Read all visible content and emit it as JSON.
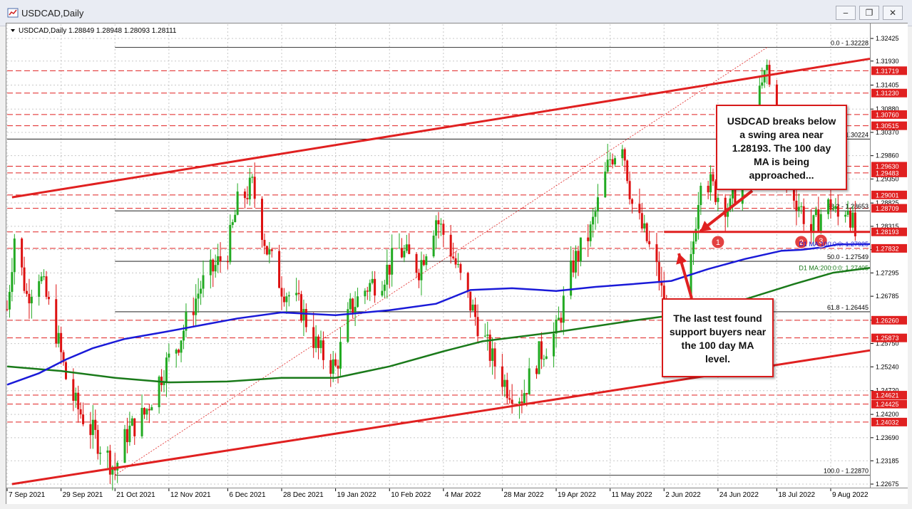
{
  "window": {
    "title": "USDCAD,Daily",
    "buttons": [
      "‒",
      "❐",
      "✕"
    ]
  },
  "header": {
    "symbol_line": "USDCAD,Daily  1.28849 1.28948 1.28093 1.28111"
  },
  "colors": {
    "up": "#22aa22",
    "down": "#dd1111",
    "ma100": "#1a1ad8",
    "ma200": "#1a7a1a",
    "trend": "#e02020",
    "level_label_bg": "#e02020"
  },
  "chart_data": {
    "type": "candlestick",
    "symbol": "USDCAD",
    "timeframe": "Daily",
    "ohlc_last": {
      "open": 1.28849,
      "high": 1.28948,
      "low": 1.28093,
      "close": 1.28111
    },
    "ylim": [
      1.22675,
      1.32425
    ],
    "xlim": [
      "2021-09-07",
      "2022-08-25"
    ],
    "y_ticks": [
      "1.32425",
      "1.31930",
      "1.31405",
      "1.30880",
      "1.30370",
      "1.29860",
      "1.29350",
      "1.28825",
      "1.28315",
      "1.27805",
      "1.27295",
      "1.26785",
      "1.26260",
      "1.25750",
      "1.25240",
      "1.24720",
      "1.24200",
      "1.23690",
      "1.23185",
      "1.22675"
    ],
    "x_ticks": [
      {
        "label": "7 Sep 2021",
        "date": "2021-09-07"
      },
      {
        "label": "29 Sep 2021",
        "date": "2021-09-29"
      },
      {
        "label": "21 Oct 2021",
        "date": "2021-10-21"
      },
      {
        "label": "12 Nov 2021",
        "date": "2021-11-12"
      },
      {
        "label": "6 Dec 2021",
        "date": "2021-12-06"
      },
      {
        "label": "28 Dec 2021",
        "date": "2021-12-28"
      },
      {
        "label": "19 Jan 2022",
        "date": "2022-01-19"
      },
      {
        "label": "10 Feb 2022",
        "date": "2022-02-10"
      },
      {
        "label": "4 Mar 2022",
        "date": "2022-03-04"
      },
      {
        "label": "28 Mar 2022",
        "date": "2022-03-28"
      },
      {
        "label": "19 Apr 2022",
        "date": "2022-04-19"
      },
      {
        "label": "11 May 2022",
        "date": "2022-05-11"
      },
      {
        "label": "2 Jun 2022",
        "date": "2022-06-02"
      },
      {
        "label": "24 Jun 2022",
        "date": "2022-06-24"
      },
      {
        "label": "18 Jul 2022",
        "date": "2022-07-18"
      },
      {
        "label": "9 Aug 2022",
        "date": "2022-08-09"
      }
    ],
    "level_labels": [
      {
        "value": "1.31719",
        "price": 1.31719
      },
      {
        "value": "1.31230",
        "price": 1.3123
      },
      {
        "value": "1.30760",
        "price": 1.3076
      },
      {
        "value": "1.30515",
        "price": 1.30515
      },
      {
        "value": "1.29630",
        "price": 1.2963
      },
      {
        "value": "1.29483",
        "price": 1.29483
      },
      {
        "value": "1.29001",
        "price": 1.29001
      },
      {
        "value": "1.28709",
        "price": 1.28709
      },
      {
        "value": "1.28193",
        "price": 1.28193
      },
      {
        "value": "1.27832",
        "price": 1.27832
      },
      {
        "value": "1.26260",
        "price": 1.2626
      },
      {
        "value": "1.25873",
        "price": 1.25873
      },
      {
        "value": "1.24621",
        "price": 1.24621
      },
      {
        "value": "1.24425",
        "price": 1.24425
      },
      {
        "value": "1.24032",
        "price": 1.24032
      }
    ],
    "fib_levels": [
      {
        "label": "0.0 - 1.32228",
        "price": 1.32228,
        "from": "2021-10-21"
      },
      {
        "label": "1.30224",
        "price": 1.30224,
        "from": "2021-09-07"
      },
      {
        "label": "38.2 - 1.28653",
        "price": 1.28653,
        "from": "2021-10-21"
      },
      {
        "label": "50.0 - 1.27549",
        "price": 1.27549,
        "from": "2021-10-21"
      },
      {
        "label": "61.8 - 1.26445",
        "price": 1.26445,
        "from": "2021-10-21"
      },
      {
        "label": "100.0 - 1.22870",
        "price": 1.2287,
        "from": "2021-10-21"
      }
    ],
    "ma_labels": [
      {
        "text": "D1 MA:100:0:0: 1.27925",
        "price": 1.27925,
        "series": "ma100"
      },
      {
        "text": "D1 MA:200:0:0: 1.27405",
        "price": 1.27405,
        "series": "ma200"
      }
    ],
    "ma100": [
      [
        "2021-09-07",
        1.2485
      ],
      [
        "2021-09-20",
        1.251
      ],
      [
        "2021-10-01",
        1.254
      ],
      [
        "2021-10-12",
        1.2565
      ],
      [
        "2021-10-25",
        1.2585
      ],
      [
        "2021-11-10",
        1.26
      ],
      [
        "2021-11-25",
        1.2615
      ],
      [
        "2021-12-10",
        1.263
      ],
      [
        "2021-12-28",
        1.2643
      ],
      [
        "2022-01-19",
        1.2637
      ],
      [
        "2022-02-10",
        1.2648
      ],
      [
        "2022-03-01",
        1.2662
      ],
      [
        "2022-03-15",
        1.2692
      ],
      [
        "2022-04-01",
        1.2696
      ],
      [
        "2022-04-19",
        1.269
      ],
      [
        "2022-05-05",
        1.2699
      ],
      [
        "2022-05-20",
        1.2705
      ],
      [
        "2022-06-05",
        1.2712
      ],
      [
        "2022-06-20",
        1.2738
      ],
      [
        "2022-07-05",
        1.276
      ],
      [
        "2022-07-20",
        1.2778
      ],
      [
        "2022-07-28",
        1.278
      ],
      [
        "2022-08-05",
        1.2785
      ],
      [
        "2022-08-12",
        1.2792
      ],
      [
        "2022-08-25",
        1.27925
      ]
    ],
    "ma200": [
      [
        "2021-09-07",
        1.2525
      ],
      [
        "2021-09-29",
        1.2515
      ],
      [
        "2021-10-21",
        1.25
      ],
      [
        "2021-11-12",
        1.249
      ],
      [
        "2021-12-06",
        1.2492
      ],
      [
        "2021-12-28",
        1.25
      ],
      [
        "2022-01-19",
        1.25
      ],
      [
        "2022-02-10",
        1.2525
      ],
      [
        "2022-03-04",
        1.2558
      ],
      [
        "2022-03-20",
        1.258
      ],
      [
        "2022-04-19",
        1.26
      ],
      [
        "2022-05-20",
        1.2625
      ],
      [
        "2022-06-10",
        1.264
      ],
      [
        "2022-07-01",
        1.2665
      ],
      [
        "2022-07-25",
        1.2705
      ],
      [
        "2022-08-10",
        1.273
      ],
      [
        "2022-08-25",
        1.27405
      ]
    ],
    "price_path": [
      [
        "2021-09-07",
        1.265
      ],
      [
        "2021-09-10",
        1.281
      ],
      [
        "2021-09-15",
        1.268
      ],
      [
        "2021-09-20",
        1.273
      ],
      [
        "2021-09-27",
        1.26
      ],
      [
        "2021-10-01",
        1.25
      ],
      [
        "2021-10-05",
        1.244
      ],
      [
        "2021-10-12",
        1.238
      ],
      [
        "2021-10-21",
        1.23
      ],
      [
        "2021-10-26",
        1.238
      ],
      [
        "2021-11-02",
        1.242
      ],
      [
        "2021-11-10",
        1.252
      ],
      [
        "2021-11-16",
        1.258
      ],
      [
        "2021-11-25",
        1.27
      ],
      [
        "2021-12-06",
        1.278
      ],
      [
        "2021-12-10",
        1.288
      ],
      [
        "2021-12-16",
        1.292
      ],
      [
        "2021-12-22",
        1.278
      ],
      [
        "2021-12-28",
        1.27
      ],
      [
        "2022-01-05",
        1.265
      ],
      [
        "2022-01-12",
        1.256
      ],
      [
        "2022-01-19",
        1.252
      ],
      [
        "2022-01-25",
        1.265
      ],
      [
        "2022-02-01",
        1.27
      ],
      [
        "2022-02-07",
        1.272
      ],
      [
        "2022-02-14",
        1.278
      ],
      [
        "2022-02-22",
        1.274
      ],
      [
        "2022-03-01",
        1.285
      ],
      [
        "2022-03-07",
        1.278
      ],
      [
        "2022-03-12",
        1.27
      ],
      [
        "2022-03-18",
        1.262
      ],
      [
        "2022-03-24",
        1.254
      ],
      [
        "2022-03-30",
        1.248
      ],
      [
        "2022-04-05",
        1.246
      ],
      [
        "2022-04-12",
        1.255
      ],
      [
        "2022-04-19",
        1.26
      ],
      [
        "2022-04-26",
        1.275
      ],
      [
        "2022-05-03",
        1.282
      ],
      [
        "2022-05-11",
        1.298
      ],
      [
        "2022-05-16",
        1.302
      ],
      [
        "2022-05-20",
        1.288
      ],
      [
        "2022-05-26",
        1.28
      ],
      [
        "2022-05-31",
        1.272
      ],
      [
        "2022-06-03",
        1.262
      ],
      [
        "2022-06-08",
        1.256
      ],
      [
        "2022-06-13",
        1.275
      ],
      [
        "2022-06-17",
        1.295
      ],
      [
        "2022-06-24",
        1.29
      ],
      [
        "2022-06-29",
        1.287
      ],
      [
        "2022-07-05",
        1.298
      ],
      [
        "2022-07-14",
        1.318
      ],
      [
        "2022-07-18",
        1.301
      ],
      [
        "2022-07-22",
        1.293
      ],
      [
        "2022-07-27",
        1.288
      ],
      [
        "2022-08-01",
        1.282
      ],
      [
        "2022-08-05",
        1.286
      ],
      [
        "2022-08-09",
        1.288
      ],
      [
        "2022-08-12",
        1.285
      ],
      [
        "2022-08-16",
        1.288
      ],
      [
        "2022-08-19",
        1.2811
      ]
    ],
    "trend_lines": [
      {
        "name": "upper-channel",
        "from": [
          "2021-09-09",
          1.2895
        ],
        "to": [
          "2022-08-31",
          1.3198
        ]
      },
      {
        "name": "lower-channel",
        "from": [
          "2021-09-09",
          1.22675
        ],
        "to": [
          "2022-08-31",
          1.256
        ]
      },
      {
        "name": "swing-level",
        "from": [
          "2022-06-02",
          1.28193
        ],
        "to": [
          "2022-08-31",
          1.28193
        ]
      }
    ],
    "markers": [
      {
        "text": "1",
        "date": "2022-06-24",
        "price": 1.2797
      },
      {
        "text": "2",
        "date": "2022-07-28",
        "price": 1.2797
      },
      {
        "text": "3",
        "date": "2022-08-05",
        "price": 1.28
      }
    ]
  },
  "annotations": {
    "breaks_text": "USDCAD breaks below a swing area near 1.28193. The 100 day MA is being approached...",
    "support_text": "The last test found support buyers near the 100 day MA level."
  }
}
